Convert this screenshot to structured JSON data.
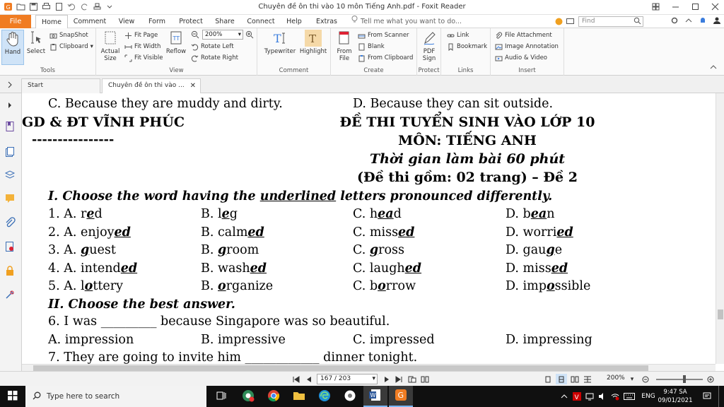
{
  "window": {
    "title": "Chuyên đề ôn thi vào 10 môn Tiếng Anh.pdf - Foxit Reader"
  },
  "ribbon_tabs": [
    "File",
    "Home",
    "Comment",
    "View",
    "Form",
    "Protect",
    "Share",
    "Connect",
    "Help",
    "Extras"
  ],
  "tell_me": "Tell me what you want to do...",
  "find_placeholder": "Find",
  "ribbon": {
    "tools": {
      "label": "Tools",
      "hand": "Hand",
      "select": "Select",
      "snapshot": "SnapShot",
      "clipboard": "Clipboard"
    },
    "view": {
      "label": "View",
      "actual_size_1": "Actual",
      "actual_size_2": "Size",
      "fit_page": "Fit Page",
      "fit_width": "Fit Width",
      "fit_visible": "Fit Visible",
      "reflow": "Reflow",
      "zoom": "200%",
      "rotate_left": "Rotate Left",
      "rotate_right": "Rotate Right"
    },
    "comment": {
      "label": "Comment",
      "typewriter": "Typewriter",
      "highlight": "Highlight"
    },
    "create": {
      "label": "Create",
      "from_file_1": "From",
      "from_file_2": "File",
      "from_scanner": "From Scanner",
      "blank": "Blank",
      "from_clipboard": "From Clipboard"
    },
    "protect": {
      "label": "Protect",
      "pdf_sign_1": "PDF",
      "pdf_sign_2": "Sign"
    },
    "links": {
      "label": "Links",
      "link": "Link",
      "bookmark": "Bookmark"
    },
    "insert": {
      "label": "Insert",
      "file_attachment": "File Attachment",
      "image_annotation": "Image Annotation",
      "audio_video": "Audio & Video"
    }
  },
  "doc_tabs": [
    "Start",
    "Chuyên đề ôn thi vào ..."
  ],
  "document": {
    "prev_c": "C. Because they are muddy and dirty.",
    "prev_d": "D. Because they can sit outside.",
    "dept": "GD & ĐT VĨNH PHÚC",
    "dashes": "----------------",
    "exam_title": "ĐỀ THI TUYỂN SINH VÀO LỚP 10",
    "subject": "MÔN: TIẾNG ANH",
    "time": "Thời gian làm bài 60 phút",
    "pages": "(Đề thi gồm: 02 trang) – Đề 2",
    "section1_a": "I. Choose the word having the ",
    "section1_u": "underlined",
    "section1_b": " letters pronounced differently.",
    "q1": {
      "a": [
        "1. A. r",
        "e",
        "d"
      ],
      "b": [
        "B. l",
        "e",
        "g"
      ],
      "c": [
        "C. h",
        "ea",
        "d"
      ],
      "d": [
        "D. b",
        "ea",
        "n"
      ]
    },
    "q2": {
      "a": [
        "2. A. enjoy",
        "ed",
        ""
      ],
      "b": [
        "B. calm",
        "ed",
        ""
      ],
      "c": [
        "C. miss",
        "ed",
        ""
      ],
      "d": [
        "D. worri",
        "ed",
        ""
      ]
    },
    "q3": {
      "a": [
        "3. A. ",
        "g",
        "uest"
      ],
      "b": [
        "B. ",
        "g",
        "room"
      ],
      "c": [
        "C. ",
        "g",
        "ross"
      ],
      "d": [
        "D. gau",
        "g",
        "e"
      ]
    },
    "q4": {
      "a": [
        "4. A. intend",
        "ed",
        ""
      ],
      "b": [
        "B. wash",
        "ed",
        ""
      ],
      "c": [
        "C. laugh",
        "ed",
        ""
      ],
      "d": [
        "D. miss",
        "ed",
        ""
      ]
    },
    "q5": {
      "a": [
        "5. A. l",
        "o",
        "ttery"
      ],
      "b": [
        "B. ",
        "o",
        "rganize"
      ],
      "c": [
        "C. b",
        "o",
        "rrow"
      ],
      "d": [
        "D. imp",
        "o",
        "ssible"
      ]
    },
    "section2": "II. Choose the best answer.",
    "q6": "6. I was _________ because Singapore was so beautiful.",
    "q6_opts": [
      "A. impression",
      "B. impressive",
      "C. impressed",
      "D. impressing"
    ],
    "q7": "7. They are going to invite him ____________ dinner tonight."
  },
  "status": {
    "page": "167 / 203",
    "zoom": "200%"
  },
  "taskbar": {
    "search": "Type here to search",
    "lang": "ENG",
    "time": "9:47 SA",
    "date": "09/01/2021"
  }
}
